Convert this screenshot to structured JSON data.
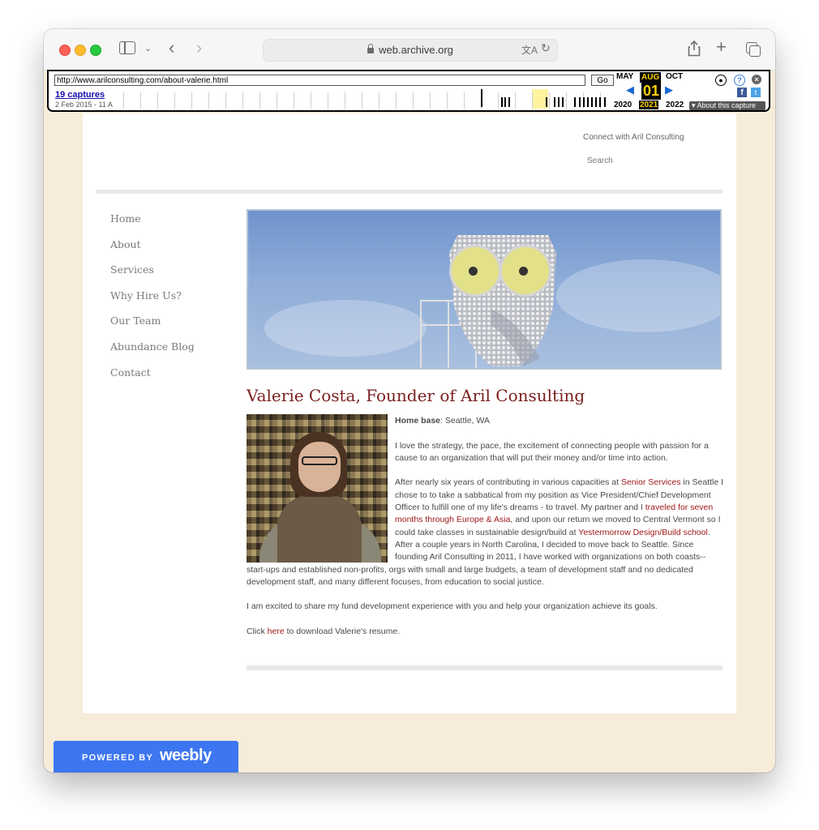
{
  "browser": {
    "url_display": "web.archive.org"
  },
  "wayback": {
    "url_input": "http://www.arilconsulting.com/about-valerie.html",
    "go_label": "Go",
    "captures_label": "19 captures",
    "date_range": "2 Feb 2015 - 11 A",
    "prev_month": "MAY",
    "current_month": "AUG",
    "next_month": "OCT",
    "current_day": "01",
    "prev_year": "2020",
    "current_year": "2021",
    "next_year": "2022",
    "about_label": "▾ About this capture"
  },
  "header": {
    "connect_text": "Connect with Aril Consulting",
    "search_text": "Search"
  },
  "nav": {
    "items": [
      "Home",
      "About",
      "Services",
      "Why Hire Us?",
      "Our Team",
      "Abundance Blog",
      "Contact"
    ]
  },
  "content": {
    "title": "Valerie Costa, Founder of Aril Consulting",
    "home_base_label": "Home base",
    "home_base_value": ": Seattle, WA",
    "para1": "I love the strategy, the pace, the excitement of connecting people with passion for a cause to an organization that will put their money and/or time into action.",
    "para2_a": "After nearly six years of contributing in various capacities at ",
    "link_senior": "Senior Services",
    "para2_b": " in Seattle I chose to to take a sabbatical from my position as Vice President/Chief Development Officer to fulfill one of my life's dreams - to travel.  My partner and I ",
    "link_travel": "traveled for seven months through Europe & Asia",
    "para2_c": ", and upon our return we moved to Central Vermont so I could take classes in sustainable design/build at ",
    "link_yestermorrow": "Yestermorrow Design/Build school",
    "para2_d": ". After a couple years in North Carolina, I decided to move back to Seattle. Since founding Aril Consulting in 2011, I have worked with organizations on both coasts--start-ups and established non-profits, orgs with small and large budgets, a team of development staff and no dedicated development staff, and many different focuses, from education to social justice.",
    "para3": "I am excited to share my fund development experience with you and help your organization achieve its goals.",
    "para4_a": "Click ",
    "link_here": "here",
    "para4_b": " to download Valerie's resume."
  },
  "footer": {
    "powered_by": "POWERED BY",
    "brand": "weebly"
  },
  "colors": {
    "accent_title": "#7b1f1f",
    "link": "#a01818",
    "weebly_blue": "#3c76f0",
    "page_bg": "#f7ecd9"
  }
}
